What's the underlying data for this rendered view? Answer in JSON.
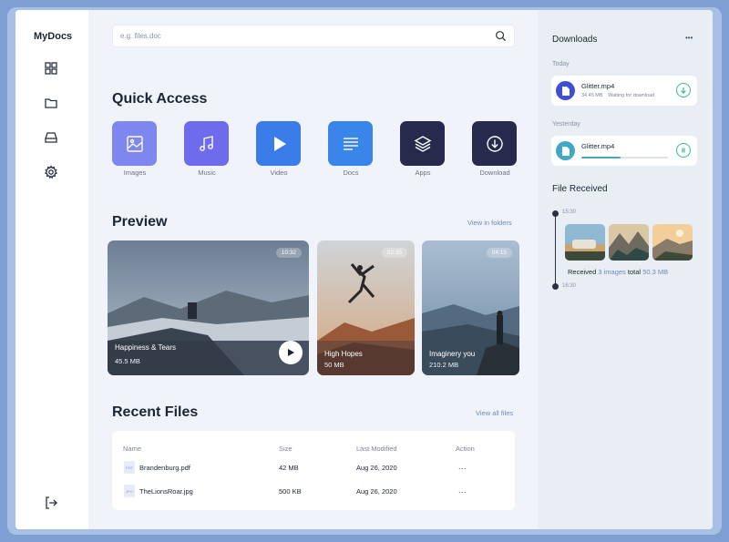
{
  "sidebar": {
    "brand": "MyDocs",
    "items": [
      {
        "name": "dashboard",
        "icon": "grid-icon"
      },
      {
        "name": "folders",
        "icon": "folder-icon"
      },
      {
        "name": "storage",
        "icon": "drive-icon"
      },
      {
        "name": "settings",
        "icon": "gear-icon"
      }
    ],
    "logout_icon": "logout-icon"
  },
  "search": {
    "placeholder": "e.g. files.doc"
  },
  "quick_access": {
    "title": "Quick Access",
    "items": [
      {
        "label": "Images",
        "color": "#7e86f0",
        "icon": "image-icon"
      },
      {
        "label": "Music",
        "color": "#6e6cec",
        "icon": "music-icon"
      },
      {
        "label": "Video",
        "color": "#3a7de8",
        "icon": "play-icon"
      },
      {
        "label": "Docs",
        "color": "#3a85ea",
        "icon": "doc-icon"
      },
      {
        "label": "Apps",
        "color": "#272a4c",
        "icon": "layers-icon"
      },
      {
        "label": "Download",
        "color": "#272a4c",
        "icon": "download-icon"
      }
    ]
  },
  "preview": {
    "title": "Preview",
    "link": "View in folders",
    "cards": [
      {
        "title": "Happiness & Tears",
        "size": "45.5 MB",
        "duration": "10:32"
      },
      {
        "title": "High Hopes",
        "size": "50 MB",
        "duration": "02:35"
      },
      {
        "title": "Imaginery you",
        "size": "210.2 MB",
        "duration": "04:15"
      }
    ]
  },
  "recent_files": {
    "title": "Recent Files",
    "link": "View all files",
    "columns": [
      "Name",
      "Size",
      "Last Modified",
      "Action"
    ],
    "rows": [
      {
        "type": "PDF",
        "name": "Brandenburg.pdf",
        "size": "42 MB",
        "modified": "Aug 26, 2020",
        "action": "..."
      },
      {
        "type": "JPG",
        "name": "TheLionsRoar.jpg",
        "size": "500 KB",
        "modified": "Aug 26, 2020",
        "action": "..."
      }
    ]
  },
  "downloads": {
    "title": "Downloads",
    "menu": "•••",
    "today_label": "Today",
    "yesterday_label": "Yesterday",
    "items": [
      {
        "name": "Glitter.mp4",
        "size": "34.45 MB",
        "status": "Waiting for download",
        "color": "#3f4ed8"
      },
      {
        "name": "Glitter.mp4",
        "progress": 0.45,
        "color": "#41a7c4"
      }
    ]
  },
  "file_received": {
    "title": "File Received",
    "start_time": "15:30",
    "end_time": "16:30",
    "text_prefix": "Received",
    "count_text": "3 images",
    "text_mid": "total",
    "total": "50.3 MB"
  }
}
